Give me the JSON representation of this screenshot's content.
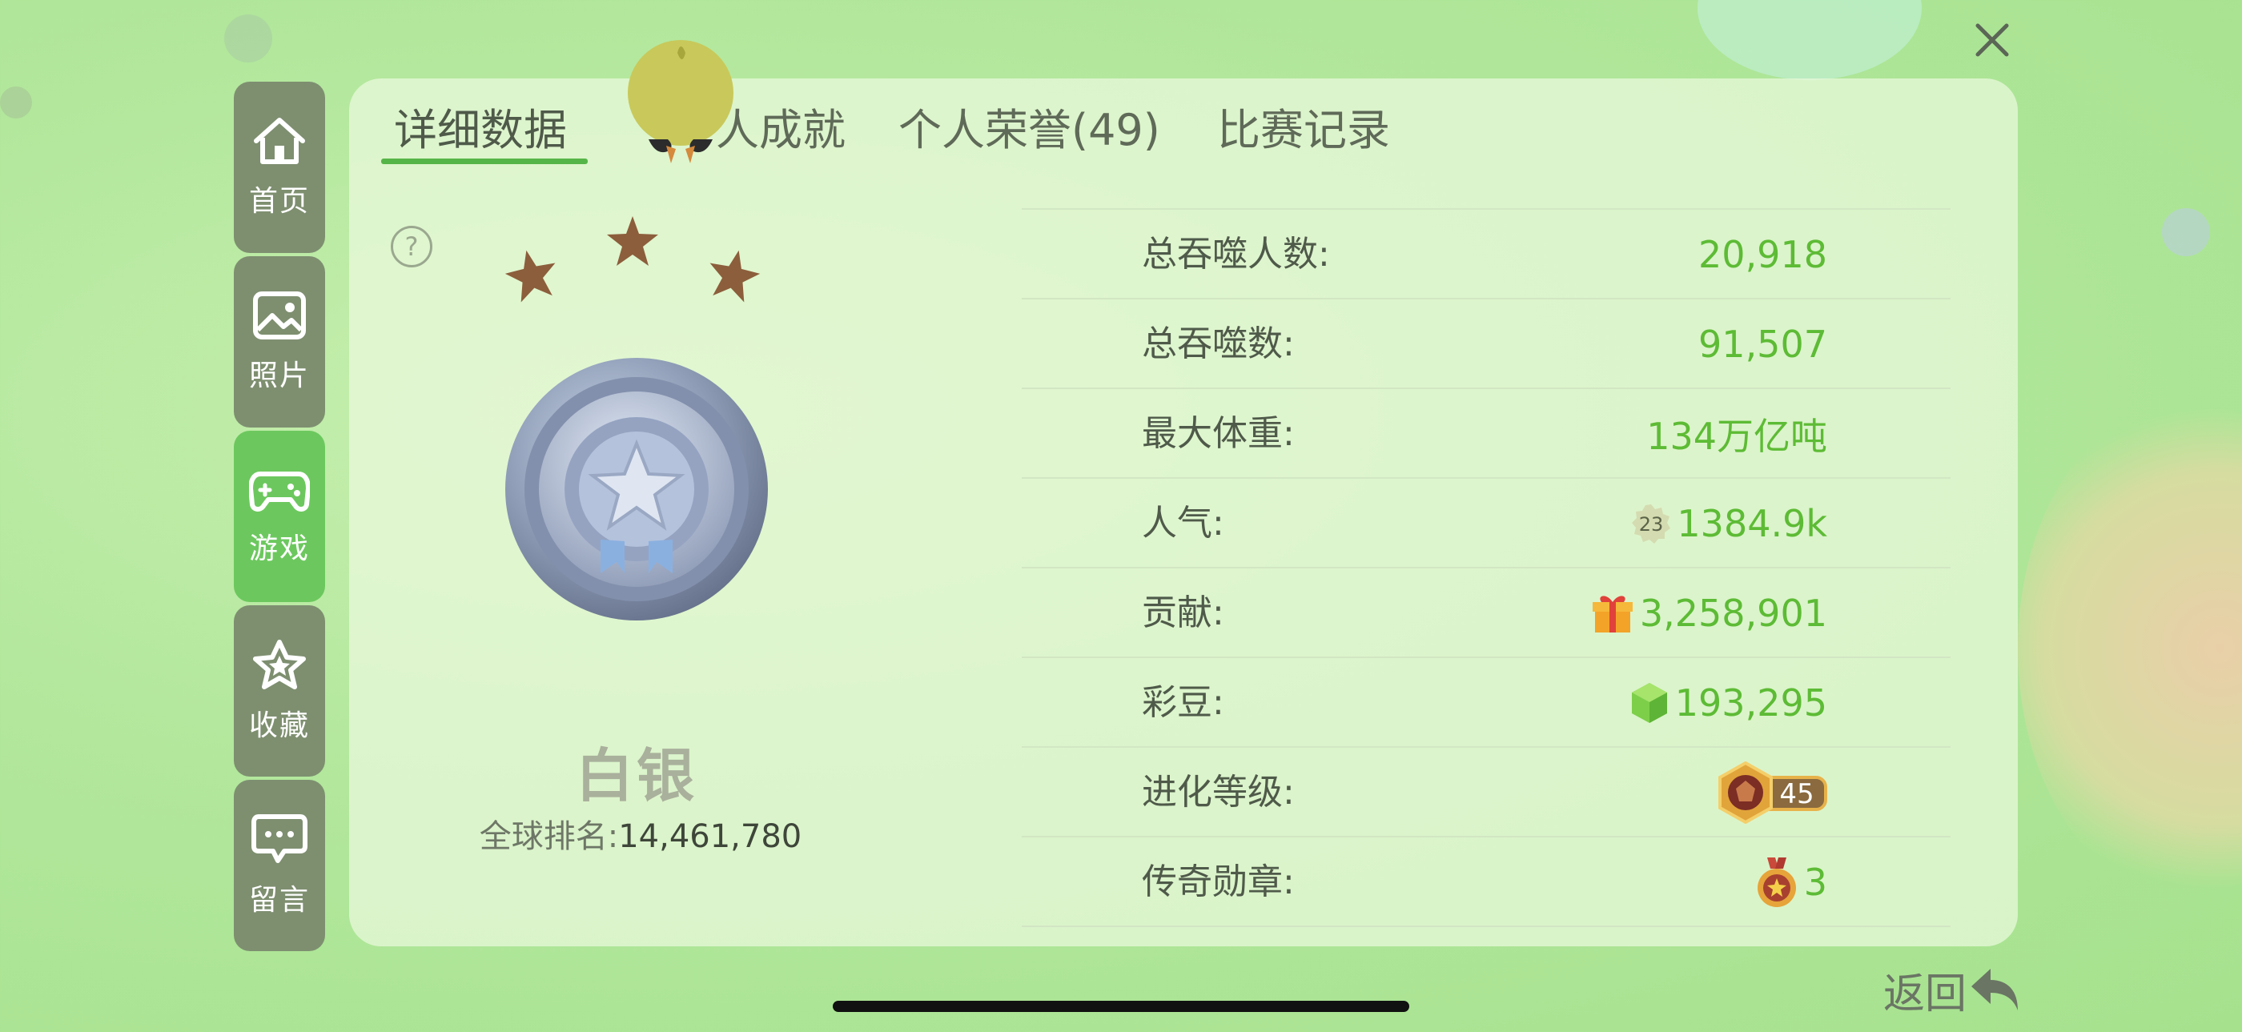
{
  "colors": {
    "accent": "#56b548",
    "value_green": "#5dbb35",
    "sidebar_bg": "#7e8f70",
    "sidebar_active": "#6cc85e"
  },
  "icons": {
    "close": "close-icon",
    "home": "home-icon",
    "photo": "photo-icon",
    "game": "gamepad-icon",
    "favorite": "star-icon",
    "message": "message-icon",
    "help": "question-icon",
    "back": "back-arrow-icon"
  },
  "sidebar": {
    "items": [
      {
        "label": "首页"
      },
      {
        "label": "照片"
      },
      {
        "label": "游戏",
        "active": true
      },
      {
        "label": "收藏"
      },
      {
        "label": "留言"
      }
    ]
  },
  "tabs": [
    {
      "label": "详细数据",
      "active": true
    },
    {
      "label": "人成就"
    },
    {
      "label": "个人荣誉(49)"
    },
    {
      "label": "比赛记录"
    }
  ],
  "rank": {
    "help": "?",
    "stars": 3,
    "name": "白银",
    "global_label": "全球排名:",
    "global_value": "14,461,780"
  },
  "stats": {
    "rows": [
      {
        "label": "总吞噬人数:",
        "value": "20,918"
      },
      {
        "label": "总吞噬数:",
        "value": "91,507"
      },
      {
        "label": "最大体重:",
        "value": "134万亿吨"
      },
      {
        "label": "人气:",
        "value": "1384.9k",
        "badge": "23"
      },
      {
        "label": "贡献:",
        "value": "3,258,901"
      },
      {
        "label": "彩豆:",
        "value": "193,295"
      },
      {
        "label": "进化等级:",
        "value": "45"
      },
      {
        "label": "传奇勋章:",
        "value": "3"
      }
    ]
  },
  "footer": {
    "back_label": "返回"
  }
}
